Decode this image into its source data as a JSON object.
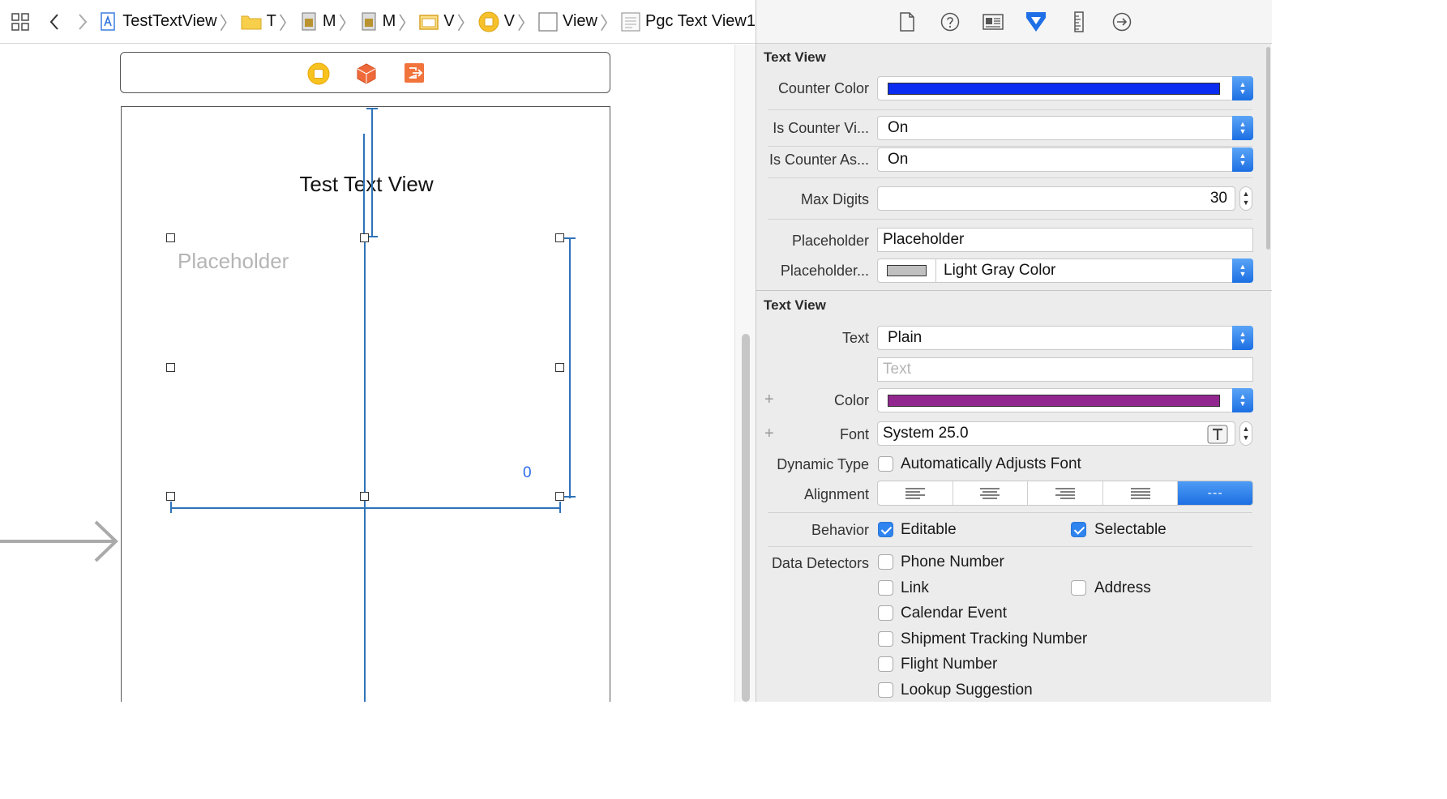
{
  "breadcrumb": {
    "items": [
      {
        "label": "TestTextView",
        "icon": "xcode-project-icon"
      },
      {
        "label": "T",
        "icon": "folder-icon"
      },
      {
        "label": "M",
        "icon": "storyboard-file-icon"
      },
      {
        "label": "M",
        "icon": "storyboard-icon"
      },
      {
        "label": "V",
        "icon": "scene-icon"
      },
      {
        "label": "V",
        "icon": "view-controller-icon"
      },
      {
        "label": "View",
        "icon": "view-icon"
      },
      {
        "label": "Pgc Text View1",
        "icon": "text-view-icon"
      }
    ]
  },
  "canvas": {
    "title_text": "Test Text View",
    "placeholder_text": "Placeholder",
    "counter_text": "0"
  },
  "inspector": {
    "section1": {
      "title": "Text View",
      "counter_color_label": "Counter Color",
      "counter_color": "#0a2cf0",
      "is_counter_visible_label": "Is Counter Vi...",
      "is_counter_visible_value": "On",
      "is_counter_as_label": "Is Counter As...",
      "is_counter_as_value": "On",
      "max_digits_label": "Max Digits",
      "max_digits_value": "30",
      "placeholder_label": "Placeholder",
      "placeholder_value": "Placeholder",
      "placeholder_color_label": "Placeholder...",
      "placeholder_color_name": "Light Gray Color",
      "placeholder_color": "#c0c0c0"
    },
    "section2": {
      "title": "Text View",
      "text_label": "Text",
      "text_value": "Plain",
      "text_field_placeholder": "Text",
      "color_label": "Color",
      "color_value": "#92278f",
      "font_label": "Font",
      "font_value": "System 25.0",
      "dynamic_type_label": "Dynamic Type",
      "auto_adjusts_label": "Automatically Adjusts Font",
      "alignment_label": "Alignment",
      "alignment_selected": "---",
      "behavior_label": "Behavior",
      "editable_label": "Editable",
      "selectable_label": "Selectable",
      "data_detectors_label": "Data Detectors",
      "phone_number_label": "Phone Number",
      "link_label": "Link",
      "address_label": "Address",
      "calendar_event_label": "Calendar Event",
      "shipment_label": "Shipment Tracking Number",
      "flight_label": "Flight Number",
      "lookup_label": "Lookup Suggestion"
    }
  }
}
